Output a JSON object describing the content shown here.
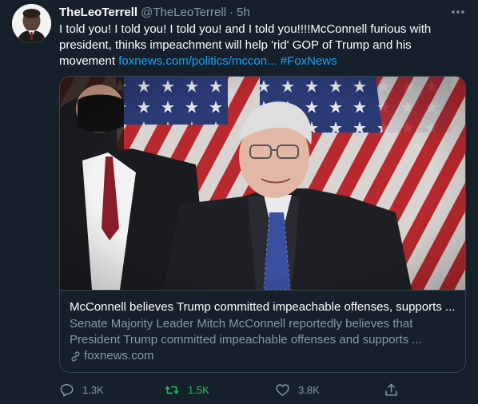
{
  "author": {
    "display_name": "TheLeoTerrell",
    "handle": "@TheLeoTerrell",
    "separator": "·",
    "time": "5h"
  },
  "tweet": {
    "text": "I told you! I told you! I told you! and I told you!!!!McConnell furious with president, thinks impeachment will help 'rid' GOP of Trump and his movement ",
    "link_text": "foxnews.com/politics/mccon...",
    "hashtag": "#FoxNews"
  },
  "card": {
    "title": "McConnell believes Trump committed impeachable offenses, supports ...",
    "description": "Senate Majority Leader Mitch McConnell reportedly believes that President Trump committed impeachable offenses and supports ...",
    "domain": "foxnews.com"
  },
  "actions": {
    "reply": {
      "icon": "reply-icon",
      "count": "1.3K"
    },
    "retweet": {
      "icon": "retweet-icon",
      "count": "1.5K",
      "color": "#17bf63"
    },
    "like": {
      "icon": "heart-icon",
      "count": "3.8K"
    },
    "share": {
      "icon": "share-icon"
    }
  },
  "colors": {
    "background": "#15202b",
    "text_primary": "#ffffff",
    "text_secondary": "#8899a6",
    "link": "#1da1f2",
    "border": "#38444d",
    "retweet_active": "#17bf63"
  }
}
